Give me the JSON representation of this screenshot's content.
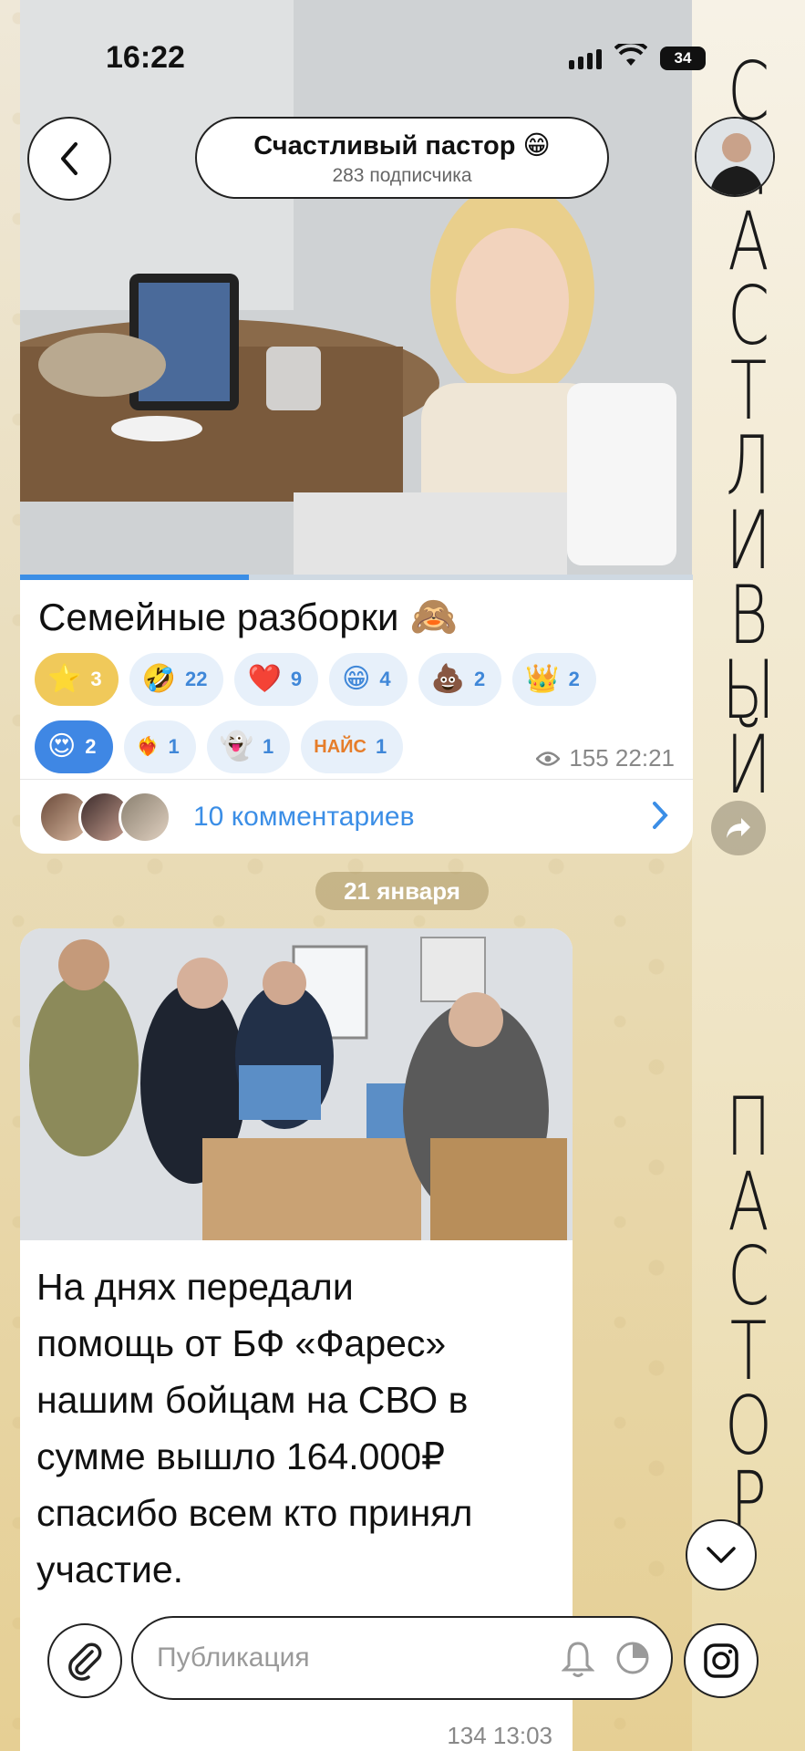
{
  "status_bar": {
    "time": "16:22",
    "battery": "34"
  },
  "header": {
    "title": "Счастливый пастор 😁",
    "subtitle": "283 подписчика"
  },
  "banner": {
    "letters_top": [
      "С",
      "Ч",
      "А",
      "С",
      "Т",
      "Л",
      "И",
      "В",
      "Ы",
      "Й"
    ],
    "letters_bottom": [
      "П",
      "А",
      "С",
      "Т",
      "О",
      "Р"
    ]
  },
  "post1": {
    "title": "Семейные разборки",
    "title_emoji": "🙈",
    "progress": 0.34,
    "reactions_row1": [
      {
        "emoji": "⭐",
        "count": "3",
        "style": "gold"
      },
      {
        "emoji": "🤣",
        "count": "22",
        "style": ""
      },
      {
        "emoji": "❤️",
        "count": "9",
        "style": ""
      },
      {
        "emoji": "😁",
        "count": "4",
        "style": ""
      },
      {
        "emoji": "💩",
        "count": "2",
        "style": ""
      },
      {
        "emoji": "👑",
        "count": "2",
        "style": ""
      }
    ],
    "reactions_row2": [
      {
        "emoji": "😍",
        "count": "2",
        "style": "active"
      },
      {
        "emoji": "❤️‍🔥",
        "count": "1",
        "style": ""
      },
      {
        "emoji": "👻",
        "count": "1",
        "style": ""
      },
      {
        "emoji": "НАЙС",
        "count": "1",
        "style": ""
      }
    ],
    "views_time": "155 22:21",
    "comments_label": "10 комментариев"
  },
  "date_separator": "21 января",
  "post2": {
    "text": "На днях передали\nпомощь от БФ «Фарес»\nнашим бойцам на СВО в\nсумме вышло 164.000₽\nспасибо всем кто принял\nучастие.",
    "meta": "134 13:03"
  },
  "composer": {
    "placeholder": "Публикация"
  },
  "colors": {
    "accent": "#3b8ee6",
    "gold": "#f0c95a"
  },
  "icons": [
    "back-icon",
    "forward-icon",
    "eye-icon",
    "chevron-right-icon",
    "chevron-down-icon",
    "paperclip-icon",
    "bell-icon",
    "timer-icon",
    "instagram-icon",
    "signal-icon",
    "wifi-icon"
  ]
}
